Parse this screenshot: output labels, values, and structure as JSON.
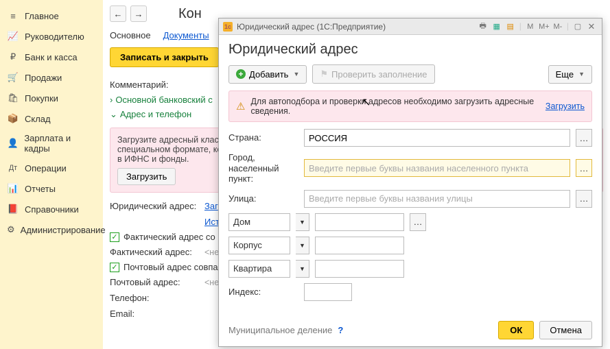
{
  "sidebar": {
    "items": [
      {
        "label": "Главное"
      },
      {
        "label": "Руководителю"
      },
      {
        "label": "Банк и касса"
      },
      {
        "label": "Продажи"
      },
      {
        "label": "Покупки"
      },
      {
        "label": "Склад"
      },
      {
        "label": "Зарплата и кадры"
      },
      {
        "label": "Операции"
      },
      {
        "label": "Отчеты"
      },
      {
        "label": "Справочники"
      },
      {
        "label": "Администрирование"
      }
    ]
  },
  "main": {
    "title_partial": "Кон",
    "tabs": {
      "main": "Основное",
      "docs": "Документы"
    },
    "save_btn": "Записать и закрыть",
    "comment_label": "Комментарий:",
    "tree": {
      "bank": "Основной банковский с",
      "address": "Адрес и телефон"
    },
    "info_box_text": "Загрузите адресный клас\nспециальном формате, ко\nв ИФНС и фонды.",
    "load_btn": "Загрузить",
    "legal_addr_label": "Юридический адрес:",
    "legal_addr_links": {
      "edit": "Заг",
      "history": "Исто"
    },
    "fact_addr_chk": "Фактический адрес со",
    "fact_addr_label": "Фактический адрес:",
    "fact_addr_val": "<не за",
    "post_addr_chk": "Почтовый адрес совпа",
    "post_addr_label": "Почтовый адрес:",
    "post_addr_val": "<не запо",
    "phone_label": "Телефон:",
    "email_label": "Email:"
  },
  "modal": {
    "titlebar": "Юридический адрес  (1С:Предприятие)",
    "tb_m": "М",
    "tb_mp": "М+",
    "tb_mm": "М-",
    "heading": "Юридический адрес",
    "add_btn": "Добавить",
    "check_btn": "Проверить заполнение",
    "more_btn": "Еще",
    "warn_text": "Для автоподбора и проверки адресов необходимо загрузить адресные сведения.",
    "warn_link": "Загрузить",
    "country_label": "Страна:",
    "country_val": "РОССИЯ",
    "city_label": "Город, населенный пункт:",
    "city_placeholder": "Введите первые буквы названия населенного пункта",
    "street_label": "Улица:",
    "street_placeholder": "Введите первые буквы названия улицы",
    "house_label": "Дом",
    "corpus_label": "Корпус",
    "flat_label": "Квартира",
    "index_label": "Индекс:",
    "muni_label": "Муниципальное деление",
    "ok_btn": "ОК",
    "cancel_btn": "Отмена"
  }
}
